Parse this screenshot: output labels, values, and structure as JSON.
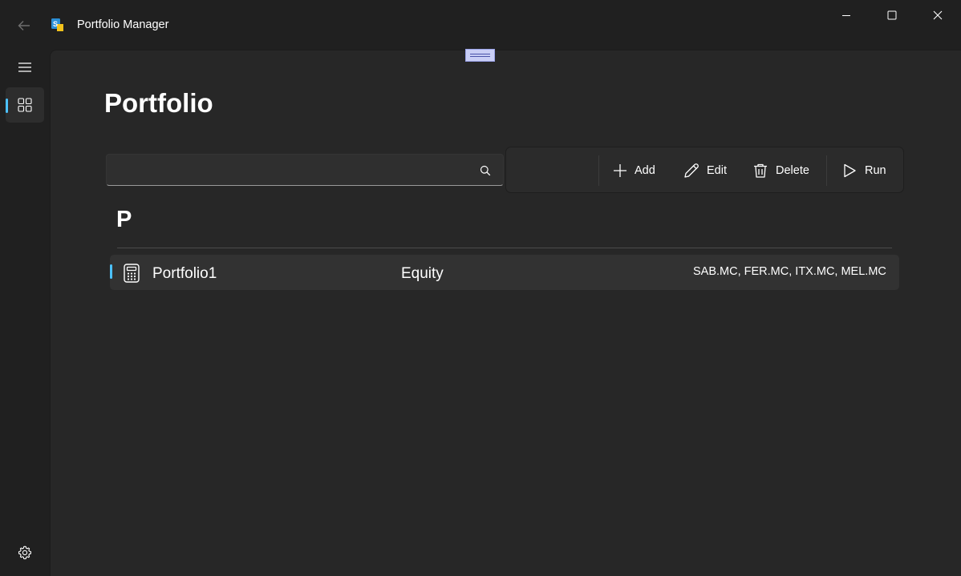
{
  "window": {
    "title": "Portfolio Manager",
    "controls": [
      "minimize",
      "maximize",
      "close"
    ]
  },
  "nav": {
    "items": [
      {
        "icon": "hamburger-menu-icon"
      },
      {
        "icon": "apps-grid-icon",
        "selected": true
      }
    ],
    "footer": {
      "icon": "settings-gear-icon"
    }
  },
  "page": {
    "title": "Portfolio"
  },
  "search": {
    "value": "",
    "placeholder": ""
  },
  "toolbar": {
    "add_label": "Add",
    "edit_label": "Edit",
    "delete_label": "Delete",
    "run_label": "Run"
  },
  "list": {
    "groups": [
      {
        "header": "P",
        "items": [
          {
            "name": "Portfolio1",
            "type": "Equity",
            "assets": "SAB.MC, FER.MC, ITX.MC, MEL.MC",
            "icon": "calculator-icon",
            "selected": true
          }
        ]
      }
    ]
  },
  "colors": {
    "accent": "#4cc2ff",
    "window_bg": "#202020",
    "content_bg": "#272727",
    "row_bg": "#323232"
  }
}
